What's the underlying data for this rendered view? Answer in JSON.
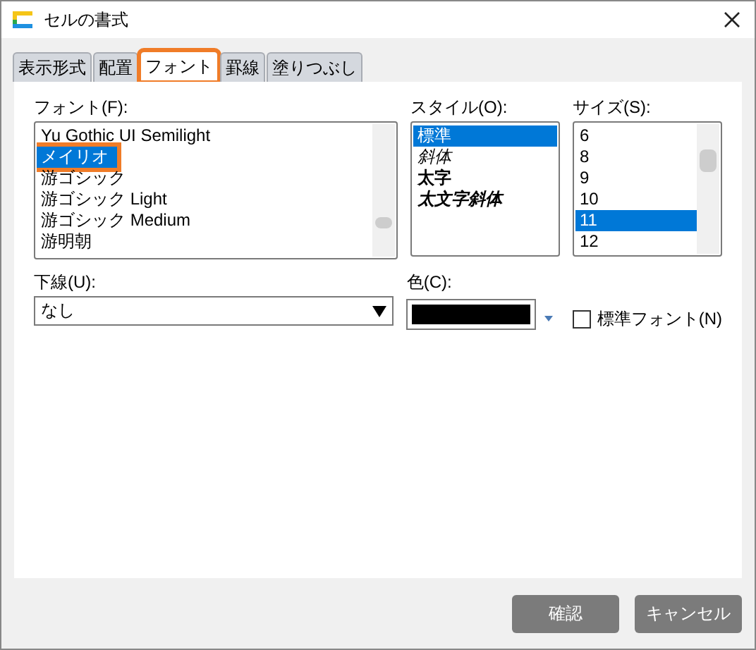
{
  "window": {
    "title": "セルの書式"
  },
  "tabs": [
    {
      "label": "表示形式",
      "selected": false,
      "highlighted": false
    },
    {
      "label": "配置",
      "selected": false,
      "highlighted": false
    },
    {
      "label": "フォント",
      "selected": true,
      "highlighted": true
    },
    {
      "label": "罫線",
      "selected": false,
      "highlighted": false
    },
    {
      "label": "塗りつぶし",
      "selected": false,
      "highlighted": false
    }
  ],
  "font": {
    "label": "フォント(F):",
    "items": [
      {
        "text": "Yu Gothic UI Semilight",
        "selected": false,
        "highlighted": false
      },
      {
        "text": "メイリオ",
        "selected": true,
        "highlighted": true
      },
      {
        "text": "游ゴシック",
        "selected": false,
        "highlighted": false
      },
      {
        "text": "游ゴシック Light",
        "selected": false,
        "highlighted": false
      },
      {
        "text": "游ゴシック Medium",
        "selected": false,
        "highlighted": false
      },
      {
        "text": "游明朝",
        "selected": false,
        "highlighted": false
      }
    ]
  },
  "style": {
    "label": "スタイル(O):",
    "items": [
      {
        "text": "標準",
        "kind": "regular",
        "selected": true
      },
      {
        "text": "斜体",
        "kind": "italic",
        "selected": false
      },
      {
        "text": "太字",
        "kind": "bold",
        "selected": false
      },
      {
        "text": "太文字斜体",
        "kind": "bold-italic",
        "selected": false
      }
    ]
  },
  "size": {
    "label": "サイズ(S):",
    "items": [
      {
        "text": "6",
        "selected": false
      },
      {
        "text": "8",
        "selected": false
      },
      {
        "text": "9",
        "selected": false
      },
      {
        "text": "10",
        "selected": false
      },
      {
        "text": "11",
        "selected": true
      },
      {
        "text": "12",
        "selected": false
      }
    ]
  },
  "underline": {
    "label": "下線(U):",
    "value": "なし"
  },
  "color": {
    "label": "色(C):",
    "color": "#000000"
  },
  "default_font": {
    "label": "標準フォント(N)",
    "checked": false
  },
  "buttons": [
    "確認",
    "キャンセル"
  ]
}
